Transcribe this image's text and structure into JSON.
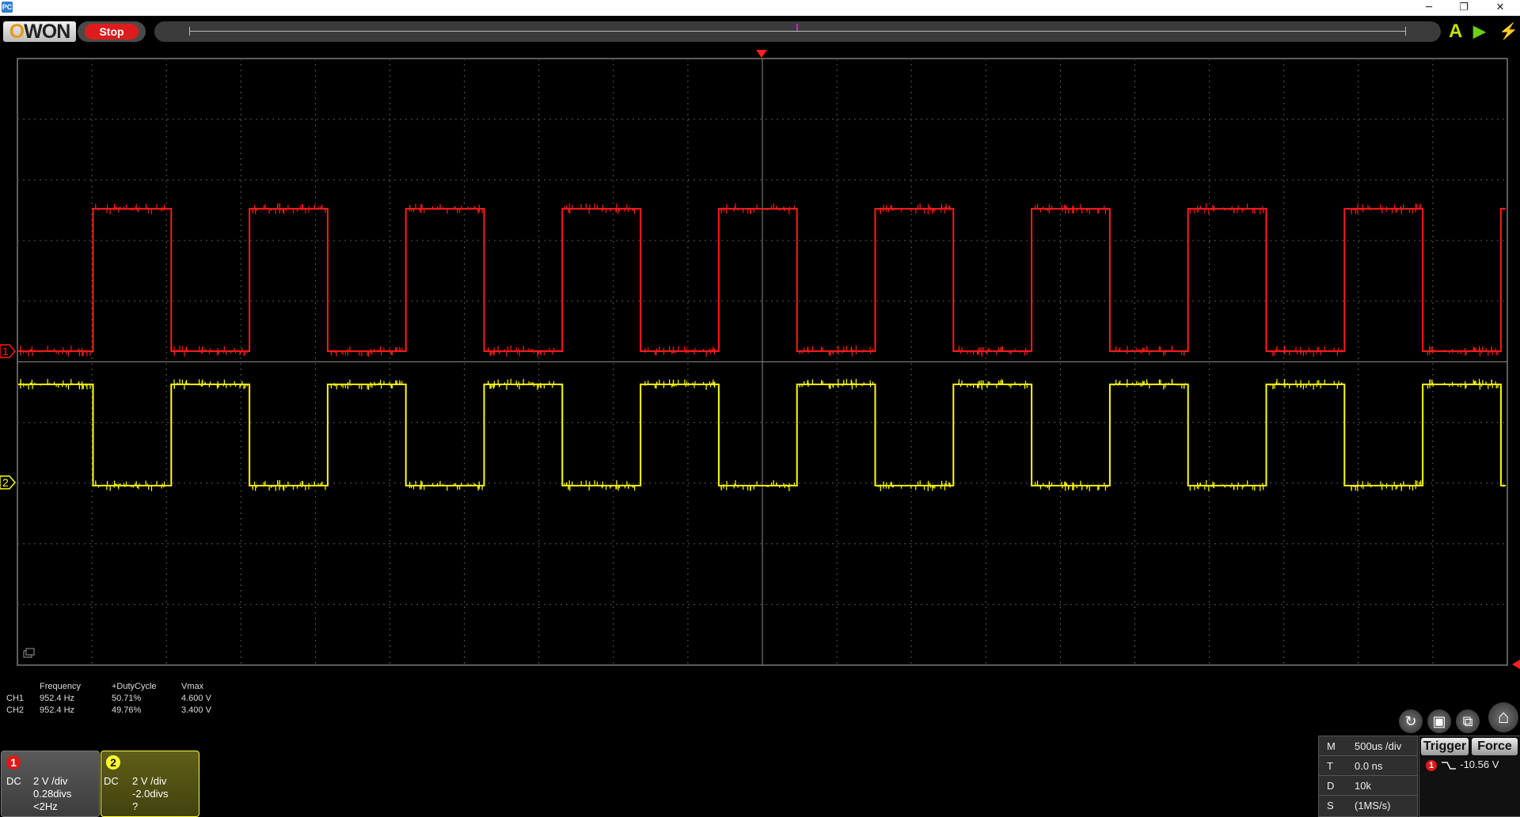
{
  "window": {
    "app_icon_label": "PC",
    "minimize": "─",
    "maximize": "❐",
    "close": "✕"
  },
  "toolbar": {
    "logo_o": "O",
    "logo_rest": "WON",
    "run_state": "Stop",
    "auto_icon": "A",
    "run_icon": "▶",
    "flash_icon": "⚡"
  },
  "channels": {
    "ch1": {
      "color": "#ff1a1a",
      "marker": "1"
    },
    "ch2": {
      "color": "#ffff00",
      "marker": "2"
    }
  },
  "measurements": {
    "headers": [
      "Frequency",
      "+DutyCycle",
      "Vmax"
    ],
    "rows": [
      {
        "channel": "CH1",
        "frequency": "952.4 Hz",
        "duty": "50.71%",
        "vmax": "4.600 V"
      },
      {
        "channel": "CH2",
        "frequency": "952.4 Hz",
        "duty": "49.76%",
        "vmax": "3.400 V"
      }
    ]
  },
  "channel_boxes": [
    {
      "badge": "1",
      "coupling": "DC",
      "scale": "2 V /div",
      "offset": "0.28divs",
      "freq": "<2Hz"
    },
    {
      "badge": "2",
      "coupling": "DC",
      "scale": "2 V /div",
      "offset": "-2.0divs",
      "freq": "?"
    }
  ],
  "info": {
    "rows": [
      {
        "key": "M",
        "value": "500us /div"
      },
      {
        "key": "T",
        "value": "0.0 ns"
      },
      {
        "key": "D",
        "value": "10k"
      },
      {
        "key": "S",
        "value": "(1MS/s)"
      }
    ]
  },
  "trigger": {
    "trigger_label": "Trigger",
    "force_label": "Force",
    "source_badge": "1",
    "slope_icon": "falling-edge-icon",
    "level": "-10.56 V"
  },
  "right_buttons": {
    "refresh_icon": "↻",
    "save_icon": "▣",
    "window_icon": "⧉",
    "home_icon": "⌂"
  }
}
